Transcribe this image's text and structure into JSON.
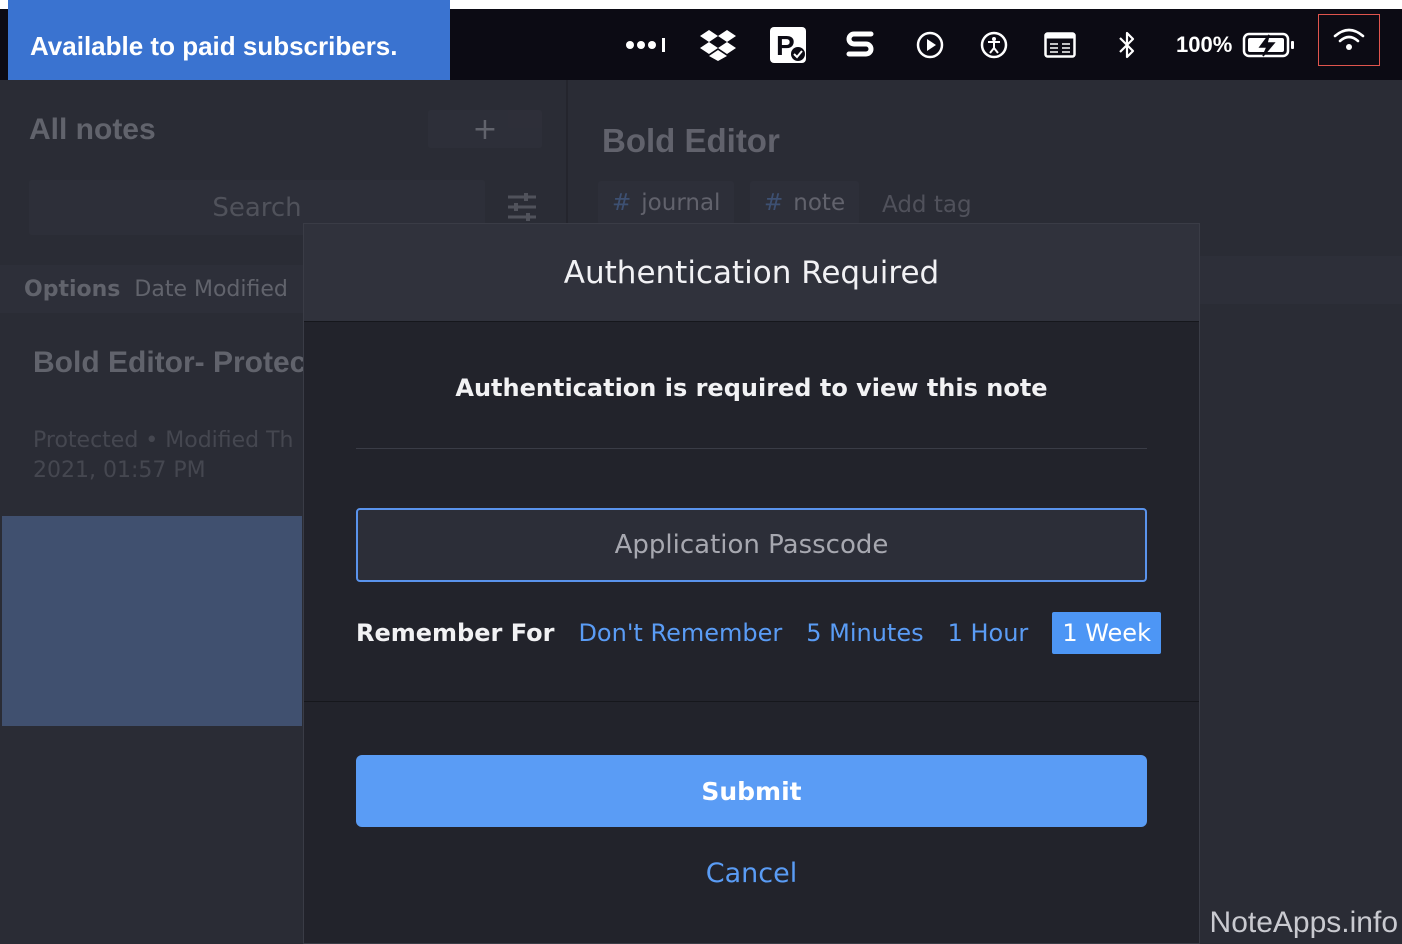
{
  "promo": {
    "text": "Available to paid subscribers."
  },
  "menubar": {
    "battery_percent": "100%",
    "icons": [
      "menu-extras-icon",
      "dropbox-icon",
      "pastebot-icon",
      "s-app-icon",
      "play-icon",
      "accessibility-icon",
      "keyboard-viewer-icon",
      "bluetooth-icon",
      "battery-charging-icon",
      "wifi-icon"
    ]
  },
  "sidebar": {
    "title": "All notes",
    "add_label": "+",
    "search_placeholder": "Search",
    "options_label": "Options",
    "sort_label": "Date Modified",
    "note": {
      "title": "Bold Editor- Protec",
      "meta_line1": "Protected • Modified Th",
      "meta_line2": "2021, 01:57 PM"
    }
  },
  "editor": {
    "title": "Bold Editor",
    "tags": [
      "journal",
      "note"
    ],
    "tag_hash": "#",
    "add_tag": "Add tag"
  },
  "modal": {
    "title": "Authentication Required",
    "prompt": "Authentication is required to view this note",
    "passcode_placeholder": "Application Passcode",
    "remember_label": "Remember For",
    "remember_options": [
      "Don't Remember",
      "5 Minutes",
      "1 Hour",
      "1 Week"
    ],
    "remember_selected": "1 Week",
    "submit_label": "Submit",
    "cancel_label": "Cancel"
  },
  "watermark": "NoteApps.info",
  "colors": {
    "accent": "#5a9cf5",
    "promo_bg": "#3a73d0",
    "menubar_bg": "#0c0b14",
    "modal_bg": "#22232b",
    "highlight_box": "#e0554e"
  }
}
